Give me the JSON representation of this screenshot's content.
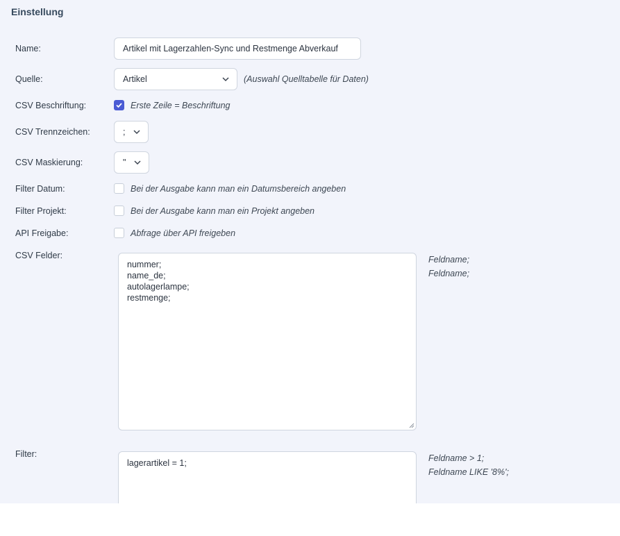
{
  "section": {
    "title": "Einstellung"
  },
  "fields": {
    "name": {
      "label": "Name:",
      "value": "Artikel mit Lagerzahlen-Sync und Restmenge Abverkauf"
    },
    "quelle": {
      "label": "Quelle:",
      "value": "Artikel",
      "hint": "(Auswahl Quelltabelle für Daten)"
    },
    "csv_beschriftung": {
      "label": "CSV Beschriftung:",
      "checked": true,
      "hint": "Erste Zeile = Beschriftung"
    },
    "csv_trennzeichen": {
      "label": "CSV Trennzeichen:",
      "value": ";"
    },
    "csv_maskierung": {
      "label": "CSV Maskierung:",
      "value": "\""
    },
    "filter_datum": {
      "label": "Filter Datum:",
      "checked": false,
      "hint": "Bei der Ausgabe kann man ein Datumsbereich angeben"
    },
    "filter_projekt": {
      "label": "Filter Projekt:",
      "checked": false,
      "hint": "Bei der Ausgabe kann man ein Projekt angeben"
    },
    "api_freigabe": {
      "label": "API Freigabe:",
      "checked": false,
      "hint": "Abfrage über API freigeben"
    },
    "csv_felder": {
      "label": "CSV Felder:",
      "lines": [
        "nummer;",
        "name_de;",
        "autolagerlampe;",
        "restmenge;"
      ],
      "hints": [
        "Feldname;",
        "Feldname;"
      ]
    },
    "filter": {
      "label": "Filter:",
      "lines": [
        "lagerartikel = 1;"
      ],
      "hints": [
        "Feldname > 1;",
        "Feldname LIKE '8%';"
      ]
    }
  },
  "icons": {
    "select_arrow": "chevron-down-icon",
    "check": "check-icon",
    "resize": "resize-handle-icon"
  },
  "colors": {
    "background": "#f2f4fb",
    "accent": "#4a5bd4"
  }
}
